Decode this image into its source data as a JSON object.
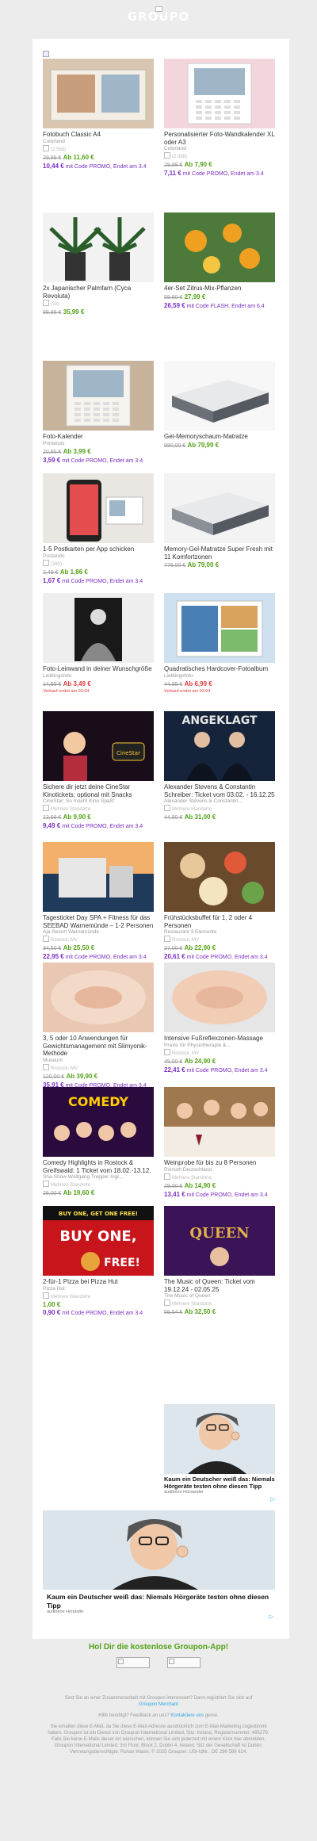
{
  "header": {
    "logo_text": "GROUPO"
  },
  "deals": [
    {
      "title": "Fotobuch Classic A4",
      "merchant": "Colorland",
      "rating": "(2.568)",
      "old": "29,99 €",
      "price": "Ab 11,60 €",
      "promo_price": "10,44 €",
      "promo_text": "mit Code PROMO, Endet am 3.4"
    },
    {
      "title": "Personalisierter Foto-Wandkalender XL oder A3",
      "merchant": "Colorland",
      "rating": "(2.388)",
      "old": "29,99 €",
      "price": "Ab 7,90 €",
      "promo_price": "7,11 €",
      "promo_text": "mit Code PROMO, Endet am 3.4"
    },
    {
      "title": "2x Japanischer Palmfarn (Cyca Revoluta)",
      "merchant": "",
      "rating": "(28)",
      "old": "99,95 €",
      "price": "35,99 €",
      "promo_price": "",
      "promo_text": ""
    },
    {
      "title": "4er-Set Zitrus-Mix-Pflanzen",
      "merchant": "",
      "rating": "",
      "old": "59,90 €",
      "price": "27,99 €",
      "promo_price": "26,59 €",
      "promo_text": "mit Code FLASH, Endet am 6.4"
    },
    {
      "title": "Foto-Kalender",
      "merchant": "Printerpix",
      "rating": "",
      "old": "20,95 €",
      "price": "Ab 3,99 €",
      "promo_price": "3,59 €",
      "promo_text": "mit Code PROMO, Endet am 3.4"
    },
    {
      "title": "Gel-Memoryschaum-Matratze",
      "merchant": "",
      "rating": "",
      "old": "980,00 €",
      "price": "Ab 79,99 €",
      "promo_price": "",
      "promo_text": ""
    },
    {
      "title": "1-5 Postkarten per App schicken",
      "merchant": "Postando",
      "rating": "(380)",
      "old": "2,49 €",
      "price": "Ab 1,86 €",
      "promo_price": "1,67 €",
      "promo_text": "mit Code PROMO, Endet am 3.4"
    },
    {
      "title": "Memory-Gel-Matratze Super Fresh mit 11 Komfortzonen",
      "merchant": "",
      "rating": "",
      "old": "778,00 €",
      "price": "Ab 79,00 €",
      "promo_price": "",
      "promo_text": ""
    },
    {
      "title": "Foto-Leinwand in deiner Wunschgröße",
      "merchant": "Lieblingsfoto",
      "rating": "",
      "old": "14,95 €",
      "price": "Ab 3,49 €",
      "promo_price": "",
      "promo_text": "",
      "avail": "Verkauf endet am 03.04"
    },
    {
      "title": "Quadratisches Hardcover-Fotoalbum",
      "merchant": "Lieblingsfoto",
      "rating": "",
      "old": "44,95 €",
      "price": "Ab 6,99 €",
      "promo_price": "",
      "promo_text": "",
      "avail": "Verkauf endet am 03.04"
    },
    {
      "title": "Sichere dir jetzt deine CineStar Kinotickets; optional mit Snacks",
      "merchant": "CineStar: So macht Kino Spaß!",
      "rating": "Mehrere Standorte",
      "old": "12,99 €",
      "price": "Ab 9,90 €",
      "promo_price": "9,49 €",
      "promo_text": "mit Code PROMO, Endet am 3.4"
    },
    {
      "title": "Alexander Stevens & Constantin Schreiber: Ticket vom 03.02. - 16.12.25",
      "merchant": "Alexander Stevens & Constantin...",
      "rating": "Mehrere Standorte",
      "old": "44,90 €",
      "price": "Ab 31,00 €",
      "promo_price": "",
      "promo_text": ""
    },
    {
      "title": "Tagesticket Day SPA + Fitness für das SEEBAD Warnemünde – 1-2 Personen",
      "merchant": "Aja Resort Warnemünde",
      "rating": "Rostock, MV",
      "old": "34,50 €",
      "price": "Ab 25,50 €",
      "promo_price": "22,95 €",
      "promo_text": "mit Code PROMO, Endet am 3.4"
    },
    {
      "title": "Frühstücksbuffet für 1, 2 oder 4 Personen",
      "merchant": "Restaurant 3 Elemente",
      "rating": "Rostock, MV",
      "old": "27,00 €",
      "price": "Ab 22,90 €",
      "promo_price": "20,61 €",
      "promo_text": "mit Code PROMO, Endet am 3.4"
    },
    {
      "title": "3, 5 oder 10 Anwendungen für Gewichtsmanagement mit Slimyonik-Methode",
      "merchant": "Museum",
      "rating": "Rostock, MV",
      "old": "120,00 €",
      "price": "Ab 39,90 €",
      "promo_price": "35,91 €",
      "promo_text": "mit Code PROMO, Endet am 3.4"
    },
    {
      "title": "Intensive Fußreflexzonen-Massage",
      "merchant": "Praxis für Physiotherapie &...",
      "rating": "Rostock, MV",
      "old": "45,00 €",
      "price": "Ab 24,90 €",
      "promo_price": "22,41 €",
      "promo_text": "mit Code PROMO, Endet am 3.4"
    },
    {
      "title": "Comedy Highlights in Rostock & Greifswald: 1 Ticket vom 18.02.-13.12.",
      "merchant": "Sha-Show Wolfgang Trepper Ingr...",
      "rating": "Mehrere Standorte",
      "old": "28,00 €",
      "price": "Ab 19,60 €",
      "promo_price": "",
      "promo_text": ""
    },
    {
      "title": "Weinprobe für bis zu 8 Personen",
      "merchant": "Pinnoth Deutschland",
      "rating": "Mehrere Standorte",
      "old": "29,00 €",
      "price": "Ab 14,90 €",
      "promo_price": "13,41 €",
      "promo_text": "mit Code PROMO, Endet am 3.4"
    },
    {
      "title": "2-für-1 Pizza bei Pizza Hut",
      "merchant": "Pizza Hut",
      "rating": "Mehrere Standorte",
      "old": "",
      "price": "1,00 €",
      "promo_price": "0,90 €",
      "promo_text": "mit Code PROMO, Endet am 3.4"
    },
    {
      "title": "The Music of Queen: Ticket vom 19.12.24 - 02.05.25",
      "merchant": "The Music of Queen",
      "rating": "Mehrere Standorte",
      "old": "59,54 €",
      "price": "Ab 32,50 €",
      "promo_price": "",
      "promo_text": ""
    }
  ],
  "ads": {
    "small_title": "Kaum ein Deutscher weiß das: Niemals Hörgeräte testen ohne diesen Tipp",
    "small_source": "audibene Hörsander",
    "big_title": "Kaum ein Deutscher weiß das: Niemals Hörgeräte testen ohne diesen Tipp",
    "big_source": "audibene Hörplatte",
    "adchoice": "▷"
  },
  "footer": {
    "app_text": "Hol Dir die kostenlose Groupon-App!",
    "line1": "Sind Sie an einer Zusammenarbeit mit Groupon interessiert? Dann registriert Sie sich auf",
    "line1_link": "Groupon Merchant",
    "line2": "Hilfe benötigt? Feedback an uns?",
    "line2_link": "Kontaktiere uns",
    "line2_end": "gerne.",
    "legal": "Sie erhalten diese E-Mail, da Sie diese E-Mail-Adresse ausdrücklich zum E-Mail-Marketing zugestimmt haben. Groupon ist ein Dienst von Groupon International Limited, Sitz: Ireland, Registernummer: 485279. Falls Sie keine E-Mails dieser Art wünschen, können Sie sich jederzeit mit einem Klick hier abmelden. Groupon International Limited, 3rd Floor, Block 2, Dublin 4, Ireland. Sitz der Gesellschaft ist Dublin; Vertretungsberechtigte: Ronan Walsh. © 2025 Groupon. USt-IdNr.: DE 296 599 624.",
    "legal_link": "hier"
  }
}
